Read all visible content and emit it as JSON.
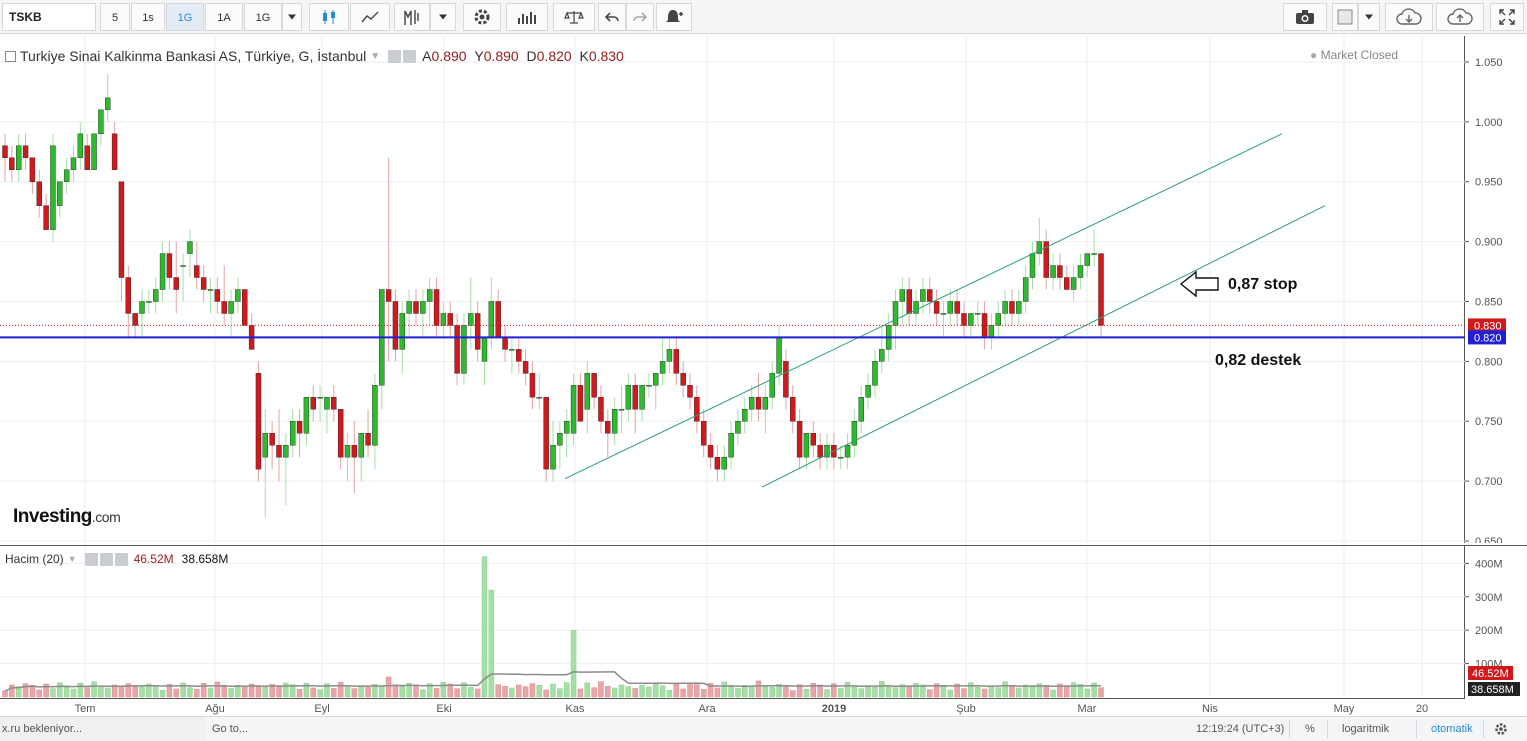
{
  "toolbar": {
    "symbol": "TSKB",
    "intervals": [
      "5",
      "1s",
      "1G",
      "1A",
      "1G"
    ],
    "active_interval": "1G",
    "colors": {
      "active": "#2a8ad4"
    },
    "icons": [
      "candles-icon",
      "line-chart-icon",
      "indicators-icon",
      "chevron-down-icon",
      "settings-icon",
      "bar-chart-icon",
      "compare-icon",
      "undo-icon",
      "redo-icon",
      "alert-icon",
      "camera-icon",
      "color-swatch-icon",
      "chevron-down-icon",
      "cloud-download-icon",
      "cloud-upload-icon",
      "fullscreen-icon"
    ]
  },
  "legend": {
    "title": "Turkiye Sinai Kalkinma Bankasi AS, Türkiye, G, İstanbul",
    "open_label": "A",
    "open": "0.890",
    "high_label": "Y",
    "high": "0.890",
    "low_label": "D",
    "low": "0.820",
    "close_label": "K",
    "close": "0.830",
    "market_status": "Market Closed"
  },
  "watermark": {
    "brand": "Investing",
    "suffix": ".com"
  },
  "volume_legend": {
    "label": "Hacim (20)",
    "value": "46.52M",
    "ma": "38.658M"
  },
  "annotations": {
    "stop": "0,87 stop",
    "support": "0,82 destek"
  },
  "statusbar": {
    "loading": "x.ru bekleniyor...",
    "goto": "Go to...",
    "time": "12:19:24 (UTC+3)",
    "percent": "%",
    "log": "logaritmik",
    "auto": "otomatik"
  },
  "chart_data": {
    "type": "candlestick",
    "title": "Turkiye Sinai Kalkinma Bankasi AS, Türkiye, G, İstanbul",
    "symbol": "TSKB",
    "interval": "G",
    "ylim": [
      0.65,
      1.07
    ],
    "y_ticks": [
      "0.650",
      "0.700",
      "0.750",
      "0.800",
      "0.850",
      "0.900",
      "0.950",
      "1.000",
      "1.050"
    ],
    "x_labels": [
      "Tem",
      "Ağu",
      "Eyl",
      "Eki",
      "Kas",
      "Ara",
      "2019",
      "Şub",
      "Mar",
      "Nis",
      "May",
      "20"
    ],
    "last_price": 0.83,
    "support_line": 0.82,
    "price_tags": [
      "0.830",
      "0.820"
    ],
    "colors": {
      "up": "#2dbb2d",
      "down": "#d0191c",
      "support": "#1f1fd6",
      "channel": "#29a07a",
      "last": "#d0191c"
    },
    "candles": [
      [
        0.98,
        0.99,
        0.95,
        0.97
      ],
      [
        0.97,
        0.98,
        0.95,
        0.96
      ],
      [
        0.96,
        0.99,
        0.95,
        0.98
      ],
      [
        0.98,
        0.99,
        0.96,
        0.97
      ],
      [
        0.97,
        0.97,
        0.94,
        0.95
      ],
      [
        0.95,
        0.96,
        0.92,
        0.93
      ],
      [
        0.93,
        0.94,
        0.91,
        0.91
      ],
      [
        0.91,
        0.99,
        0.9,
        0.98
      ],
      [
        0.93,
        0.95,
        0.92,
        0.95
      ],
      [
        0.95,
        0.97,
        0.94,
        0.96
      ],
      [
        0.96,
        0.98,
        0.95,
        0.97
      ],
      [
        0.97,
        1.0,
        0.96,
        0.99
      ],
      [
        0.98,
        0.99,
        0.96,
        0.96
      ],
      [
        0.96,
        0.99,
        0.96,
        0.99
      ],
      [
        0.99,
        1.01,
        0.98,
        1.01
      ],
      [
        1.01,
        1.04,
        1.0,
        1.02
      ],
      [
        0.99,
        1.0,
        0.96,
        0.96
      ],
      [
        0.95,
        0.95,
        0.85,
        0.87
      ],
      [
        0.87,
        0.88,
        0.82,
        0.84
      ],
      [
        0.84,
        0.84,
        0.82,
        0.83
      ],
      [
        0.84,
        0.86,
        0.82,
        0.85
      ],
      [
        0.85,
        0.86,
        0.84,
        0.85
      ],
      [
        0.85,
        0.87,
        0.84,
        0.86
      ],
      [
        0.86,
        0.9,
        0.85,
        0.89
      ],
      [
        0.89,
        0.9,
        0.86,
        0.87
      ],
      [
        0.87,
        0.9,
        0.84,
        0.86
      ],
      [
        0.88,
        0.89,
        0.85,
        0.88
      ],
      [
        0.89,
        0.91,
        0.87,
        0.9
      ],
      [
        0.88,
        0.9,
        0.86,
        0.87
      ],
      [
        0.87,
        0.88,
        0.85,
        0.86
      ],
      [
        0.86,
        0.87,
        0.84,
        0.86
      ],
      [
        0.86,
        0.87,
        0.84,
        0.85
      ],
      [
        0.85,
        0.88,
        0.83,
        0.84
      ],
      [
        0.84,
        0.86,
        0.82,
        0.85
      ],
      [
        0.85,
        0.87,
        0.84,
        0.86
      ],
      [
        0.86,
        0.86,
        0.83,
        0.83
      ],
      [
        0.83,
        0.84,
        0.81,
        0.81
      ],
      [
        0.79,
        0.8,
        0.7,
        0.71
      ],
      [
        0.72,
        0.76,
        0.67,
        0.74
      ],
      [
        0.74,
        0.75,
        0.71,
        0.73
      ],
      [
        0.73,
        0.76,
        0.7,
        0.72
      ],
      [
        0.72,
        0.74,
        0.68,
        0.73
      ],
      [
        0.73,
        0.76,
        0.72,
        0.75
      ],
      [
        0.75,
        0.76,
        0.72,
        0.74
      ],
      [
        0.74,
        0.77,
        0.73,
        0.77
      ],
      [
        0.77,
        0.78,
        0.75,
        0.76
      ],
      [
        0.77,
        0.78,
        0.75,
        0.77
      ],
      [
        0.76,
        0.77,
        0.74,
        0.77
      ],
      [
        0.77,
        0.78,
        0.75,
        0.76
      ],
      [
        0.76,
        0.76,
        0.71,
        0.72
      ],
      [
        0.72,
        0.74,
        0.7,
        0.73
      ],
      [
        0.73,
        0.75,
        0.69,
        0.72
      ],
      [
        0.72,
        0.74,
        0.7,
        0.74
      ],
      [
        0.74,
        0.76,
        0.72,
        0.73
      ],
      [
        0.73,
        0.79,
        0.71,
        0.78
      ],
      [
        0.78,
        0.85,
        0.76,
        0.86
      ],
      [
        0.86,
        0.97,
        0.8,
        0.85
      ],
      [
        0.85,
        0.86,
        0.8,
        0.81
      ],
      [
        0.81,
        0.85,
        0.79,
        0.84
      ],
      [
        0.84,
        0.86,
        0.82,
        0.85
      ],
      [
        0.85,
        0.86,
        0.83,
        0.84
      ],
      [
        0.84,
        0.86,
        0.82,
        0.85
      ],
      [
        0.85,
        0.87,
        0.83,
        0.86
      ],
      [
        0.86,
        0.87,
        0.82,
        0.83
      ],
      [
        0.83,
        0.85,
        0.82,
        0.84
      ],
      [
        0.84,
        0.85,
        0.82,
        0.83
      ],
      [
        0.83,
        0.84,
        0.78,
        0.79
      ],
      [
        0.79,
        0.84,
        0.78,
        0.83
      ],
      [
        0.83,
        0.87,
        0.81,
        0.84
      ],
      [
        0.84,
        0.85,
        0.8,
        0.81
      ],
      [
        0.8,
        0.82,
        0.78,
        0.82
      ],
      [
        0.82,
        0.87,
        0.81,
        0.85
      ],
      [
        0.85,
        0.86,
        0.82,
        0.82
      ],
      [
        0.82,
        0.83,
        0.8,
        0.81
      ],
      [
        0.81,
        0.82,
        0.79,
        0.81
      ],
      [
        0.81,
        0.82,
        0.79,
        0.8
      ],
      [
        0.8,
        0.81,
        0.78,
        0.79
      ],
      [
        0.79,
        0.8,
        0.76,
        0.77
      ],
      [
        0.77,
        0.79,
        0.76,
        0.77
      ],
      [
        0.77,
        0.77,
        0.7,
        0.71
      ],
      [
        0.71,
        0.75,
        0.7,
        0.73
      ],
      [
        0.73,
        0.75,
        0.71,
        0.74
      ],
      [
        0.74,
        0.76,
        0.72,
        0.75
      ],
      [
        0.74,
        0.79,
        0.73,
        0.78
      ],
      [
        0.78,
        0.79,
        0.75,
        0.75
      ],
      [
        0.76,
        0.8,
        0.74,
        0.79
      ],
      [
        0.79,
        0.79,
        0.76,
        0.77
      ],
      [
        0.77,
        0.78,
        0.74,
        0.75
      ],
      [
        0.75,
        0.76,
        0.72,
        0.74
      ],
      [
        0.74,
        0.77,
        0.73,
        0.76
      ],
      [
        0.76,
        0.78,
        0.74,
        0.76
      ],
      [
        0.76,
        0.79,
        0.75,
        0.78
      ],
      [
        0.78,
        0.79,
        0.74,
        0.76
      ],
      [
        0.76,
        0.78,
        0.75,
        0.78
      ],
      [
        0.78,
        0.79,
        0.77,
        0.78
      ],
      [
        0.78,
        0.79,
        0.76,
        0.79
      ],
      [
        0.79,
        0.82,
        0.78,
        0.8
      ],
      [
        0.8,
        0.82,
        0.79,
        0.81
      ],
      [
        0.81,
        0.82,
        0.78,
        0.79
      ],
      [
        0.79,
        0.8,
        0.77,
        0.78
      ],
      [
        0.78,
        0.79,
        0.76,
        0.77
      ],
      [
        0.77,
        0.78,
        0.74,
        0.75
      ],
      [
        0.75,
        0.76,
        0.72,
        0.73
      ],
      [
        0.73,
        0.74,
        0.71,
        0.72
      ],
      [
        0.72,
        0.73,
        0.7,
        0.71
      ],
      [
        0.71,
        0.73,
        0.7,
        0.72
      ],
      [
        0.72,
        0.75,
        0.71,
        0.74
      ],
      [
        0.74,
        0.76,
        0.73,
        0.75
      ],
      [
        0.75,
        0.77,
        0.74,
        0.76
      ],
      [
        0.76,
        0.78,
        0.75,
        0.77
      ],
      [
        0.77,
        0.79,
        0.75,
        0.76
      ],
      [
        0.76,
        0.78,
        0.74,
        0.77
      ],
      [
        0.77,
        0.8,
        0.76,
        0.79
      ],
      [
        0.79,
        0.83,
        0.78,
        0.82
      ],
      [
        0.8,
        0.81,
        0.76,
        0.77
      ],
      [
        0.77,
        0.78,
        0.74,
        0.75
      ],
      [
        0.75,
        0.76,
        0.71,
        0.72
      ],
      [
        0.72,
        0.74,
        0.71,
        0.74
      ],
      [
        0.74,
        0.75,
        0.72,
        0.73
      ],
      [
        0.73,
        0.74,
        0.71,
        0.72
      ],
      [
        0.72,
        0.74,
        0.71,
        0.73
      ],
      [
        0.73,
        0.74,
        0.71,
        0.72
      ],
      [
        0.72,
        0.73,
        0.71,
        0.72
      ],
      [
        0.72,
        0.74,
        0.71,
        0.73
      ],
      [
        0.73,
        0.76,
        0.72,
        0.75
      ],
      [
        0.75,
        0.78,
        0.74,
        0.77
      ],
      [
        0.77,
        0.79,
        0.76,
        0.78
      ],
      [
        0.78,
        0.81,
        0.77,
        0.8
      ],
      [
        0.8,
        0.83,
        0.79,
        0.81
      ],
      [
        0.81,
        0.84,
        0.8,
        0.83
      ],
      [
        0.83,
        0.86,
        0.81,
        0.85
      ],
      [
        0.85,
        0.87,
        0.83,
        0.86
      ],
      [
        0.86,
        0.87,
        0.83,
        0.84
      ],
      [
        0.84,
        0.86,
        0.83,
        0.85
      ],
      [
        0.85,
        0.87,
        0.84,
        0.86
      ],
      [
        0.86,
        0.87,
        0.84,
        0.85
      ],
      [
        0.85,
        0.86,
        0.83,
        0.84
      ],
      [
        0.84,
        0.85,
        0.82,
        0.84
      ],
      [
        0.84,
        0.86,
        0.83,
        0.85
      ],
      [
        0.85,
        0.86,
        0.83,
        0.84
      ],
      [
        0.84,
        0.85,
        0.82,
        0.83
      ],
      [
        0.83,
        0.84,
        0.82,
        0.84
      ],
      [
        0.84,
        0.85,
        0.83,
        0.84
      ],
      [
        0.84,
        0.85,
        0.81,
        0.82
      ],
      [
        0.82,
        0.84,
        0.81,
        0.83
      ],
      [
        0.83,
        0.85,
        0.82,
        0.84
      ],
      [
        0.84,
        0.86,
        0.83,
        0.85
      ],
      [
        0.85,
        0.86,
        0.83,
        0.84
      ],
      [
        0.84,
        0.86,
        0.83,
        0.85
      ],
      [
        0.85,
        0.88,
        0.84,
        0.87
      ],
      [
        0.87,
        0.9,
        0.86,
        0.89
      ],
      [
        0.89,
        0.92,
        0.88,
        0.9
      ],
      [
        0.9,
        0.91,
        0.86,
        0.87
      ],
      [
        0.87,
        0.89,
        0.86,
        0.88
      ],
      [
        0.88,
        0.89,
        0.86,
        0.87
      ],
      [
        0.87,
        0.88,
        0.86,
        0.86
      ],
      [
        0.86,
        0.88,
        0.85,
        0.87
      ],
      [
        0.87,
        0.89,
        0.86,
        0.88
      ],
      [
        0.88,
        0.89,
        0.87,
        0.89
      ],
      [
        0.89,
        0.91,
        0.88,
        0.89
      ],
      [
        0.89,
        0.89,
        0.82,
        0.83
      ]
    ],
    "volume": {
      "label": "Hacim (20)",
      "last": "46.52M",
      "ma": "38.658M",
      "ylim_millions": [
        0,
        440
      ],
      "y_ticks": [
        "100M",
        "200M",
        "300M",
        "400M"
      ],
      "spikes_millions": {
        "70": 420,
        "71": 320,
        "83": 200,
        "56": 60
      }
    },
    "channels": [
      {
        "from": [
          0.565,
          0.702
        ],
        "to": [
          1.282,
          0.99
        ]
      },
      {
        "from": [
          0.762,
          0.695
        ],
        "to": [
          1.325,
          0.93
        ]
      }
    ]
  }
}
